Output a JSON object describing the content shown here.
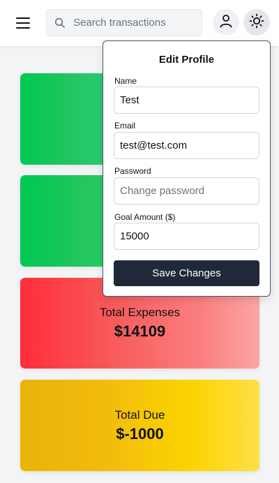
{
  "header": {
    "search": {
      "placeholder": "Search transactions",
      "value": ""
    },
    "icons": {
      "menu": "menu-icon",
      "search": "search-icon",
      "profile": "user-icon",
      "theme": "sun-icon"
    }
  },
  "cards": {
    "expenses": {
      "label": "Total Expenses",
      "value": "$14109"
    },
    "due": {
      "label": "Total Due",
      "value": "$-1000"
    }
  },
  "profile_popover": {
    "title": "Edit Profile",
    "name": {
      "label": "Name",
      "value": "Test"
    },
    "email": {
      "label": "Email",
      "value": "test@test.com"
    },
    "password": {
      "label": "Password",
      "placeholder": "Change password",
      "value": ""
    },
    "goal": {
      "label": "Goal Amount ($)",
      "value": "15000"
    },
    "save_label": "Save Changes"
  },
  "colors": {
    "save_button": "#1f2937",
    "income_green": "#00c853",
    "expenses_red": "#ff2d3a",
    "due_yellow": "#eab308"
  }
}
